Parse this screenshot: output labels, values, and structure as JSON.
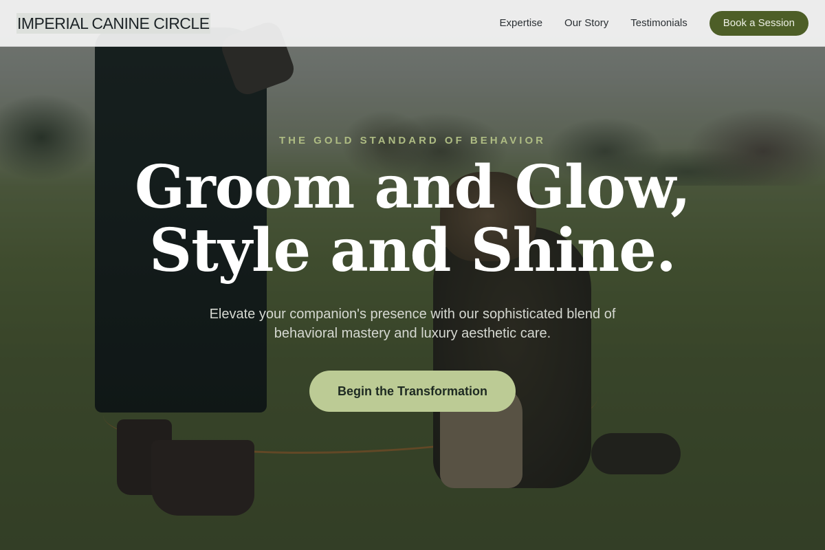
{
  "navbar": {
    "logo": "IMPERIAL CANINE CIRCLE",
    "links": [
      "Expertise",
      "Our Story",
      "Testimonials"
    ],
    "cta_label": "Book a Session"
  },
  "hero": {
    "eyebrow": "THE GOLD STANDARD OF BEHAVIOR",
    "headline_line1": "Groom and Glow,",
    "headline_line2": "Style and Shine.",
    "subtitle": "Elevate your companion's presence with our sophisticated blend of behavioral mastery and luxury aesthetic care.",
    "cta_label": "Begin the Transformation"
  },
  "colors": {
    "brand_dark_green": "#4d5e27",
    "accent_sage": "#bccb95",
    "eyebrow_text": "#aebc83"
  }
}
